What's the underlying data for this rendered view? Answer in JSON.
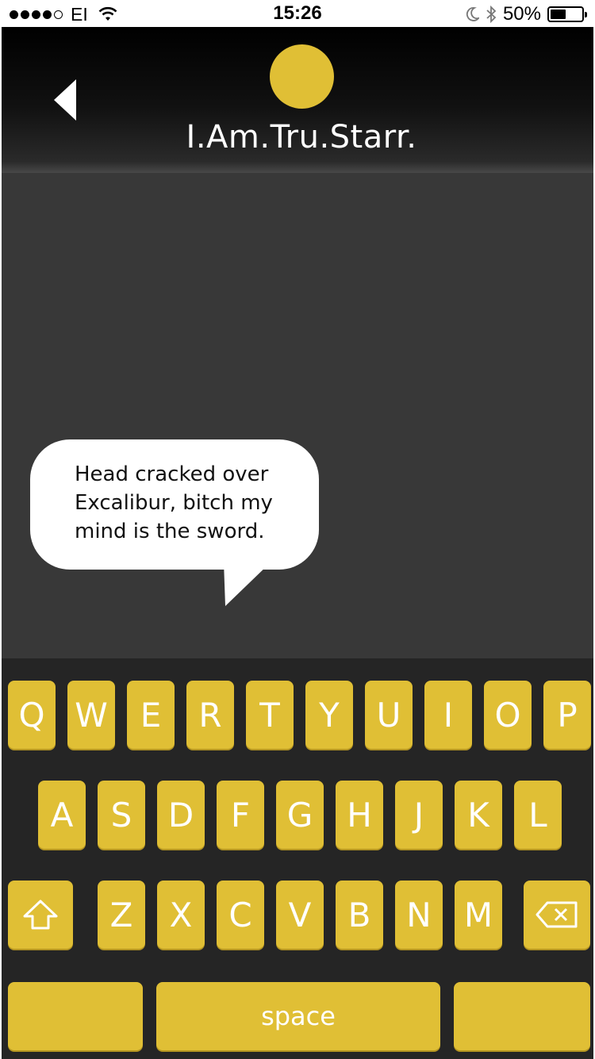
{
  "status_bar": {
    "carrier": "EI",
    "time": "15:26",
    "battery_percent": "50%",
    "battery_level": 0.5,
    "signal_bars": 4,
    "icons": [
      "signal-dots-icon",
      "wifi-icon",
      "moon-icon",
      "bluetooth-icon",
      "battery-icon"
    ]
  },
  "header": {
    "title": "I.Am.Tru.Starr.",
    "avatar_color": "#e0bf35",
    "back_icon": "back-arrow-icon"
  },
  "chat": {
    "message": "Head cracked over Excalibur, bitch my mind is the sword."
  },
  "keyboard": {
    "key_color": "#e0bf35",
    "row1": [
      "Q",
      "W",
      "E",
      "R",
      "T",
      "Y",
      "U",
      "I",
      "O",
      "P"
    ],
    "row2": [
      "A",
      "S",
      "D",
      "F",
      "G",
      "H",
      "J",
      "K",
      "L"
    ],
    "row3": [
      "Z",
      "X",
      "C",
      "V",
      "B",
      "N",
      "M"
    ],
    "shift_icon": "shift-arrow-icon",
    "backspace_icon": "backspace-icon",
    "space_label": "space",
    "left_key_label": "",
    "right_key_label": ""
  }
}
